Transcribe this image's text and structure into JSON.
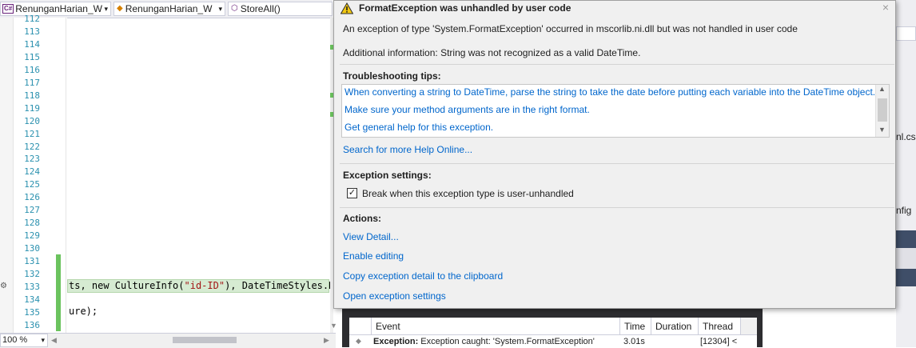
{
  "navbar": {
    "project_dropdown": "RenunganHarian_W",
    "class_dropdown": "RenunganHarian_W",
    "member_dropdown": "StoreAll()",
    "cs_badge": "C#"
  },
  "editor": {
    "line_numbers": [
      "112",
      "113",
      "114",
      "115",
      "116",
      "117",
      "118",
      "119",
      "120",
      "121",
      "122",
      "123",
      "124",
      "125",
      "126",
      "127",
      "128",
      "129",
      "130",
      "131",
      "132",
      "133",
      "134",
      "135",
      "136"
    ],
    "code_line_133_a": "ts, new CultureInfo(",
    "code_line_133_str": "\"id-ID\"",
    "code_line_133_b": "), DateTimeStyles.No",
    "code_line_135": "ure);"
  },
  "statusbar": {
    "zoom": "100 %"
  },
  "popup": {
    "title": "FormatException was unhandled by user code",
    "close": "×",
    "message": "An exception of type 'System.FormatException' occurred in mscorlib.ni.dll but was not handled in user code",
    "additional_info": "Additional information: String was not recognized as a valid DateTime.",
    "troubleshooting_header": "Troubleshooting tips:",
    "tips": [
      "When converting a string to DateTime, parse the string to take the date before putting each variable into the DateTime object.",
      "Make sure your method arguments are in the right format.",
      "Get general help for this exception."
    ],
    "search_online": "Search for more Help Online...",
    "exception_settings_header": "Exception settings:",
    "break_checkbox_label": "Break when this exception type is user-unhandled",
    "break_checkbox_checked": true,
    "actions_header": "Actions:",
    "actions": [
      "View Detail...",
      "Enable editing",
      "Copy exception detail to the clipboard",
      "Open exception settings"
    ]
  },
  "right_panel": {
    "text1": "nl.cs",
    "text2": "nfig"
  },
  "diagnostics": {
    "headers": [
      "Event",
      "Time",
      "Duration",
      "Thread"
    ],
    "row_event_bold": "Exception:",
    "row_event_text": "Exception caught: 'System.FormatException'",
    "row_time": "3.01s",
    "row_thread": "[12304] <"
  },
  "colors": {
    "link": "#0066cc",
    "line_number": "#2b91af",
    "change_bar": "#6bc35e",
    "current_line": "#d6ebd2",
    "warning": "#f2c811"
  }
}
